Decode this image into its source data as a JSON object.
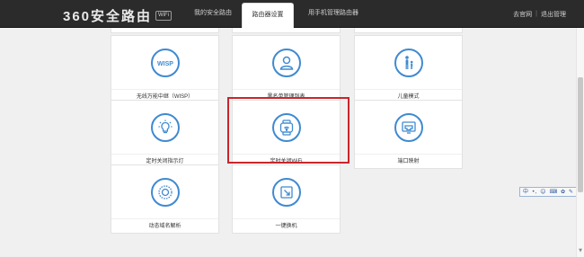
{
  "header": {
    "logo": "360安全路由",
    "logo_badge": "WiFi",
    "tabs": [
      {
        "label": "我的安全路由"
      },
      {
        "label": "路由器设置"
      },
      {
        "label": "用手机管理路由器"
      }
    ],
    "links": [
      "去官网",
      "退出管理"
    ],
    "separator": "|"
  },
  "cards": [
    {
      "label": "无线万能中继（WISP）",
      "icon": "wisp-icon"
    },
    {
      "label": "黑名单管理列表",
      "icon": "user-blacklist-icon"
    },
    {
      "label": "儿童模式",
      "icon": "child-mode-icon"
    },
    {
      "label": "定时关闭指示灯",
      "icon": "lightbulb-icon"
    },
    {
      "label": "定时关闭WiFi",
      "icon": "wifi-timer-icon"
    },
    {
      "label": "端口映射",
      "icon": "port-mapping-icon"
    },
    {
      "label": "动态域名解析",
      "icon": "ddns-icon"
    },
    {
      "label": "一键换机",
      "icon": "one-click-switch-icon"
    }
  ],
  "float_toolbar": {
    "items": [
      "中",
      "•,",
      "☺",
      "⌨",
      "✿",
      "✎"
    ]
  },
  "accent_color": "#3f8ad1",
  "highlight_color": "#c8262b"
}
